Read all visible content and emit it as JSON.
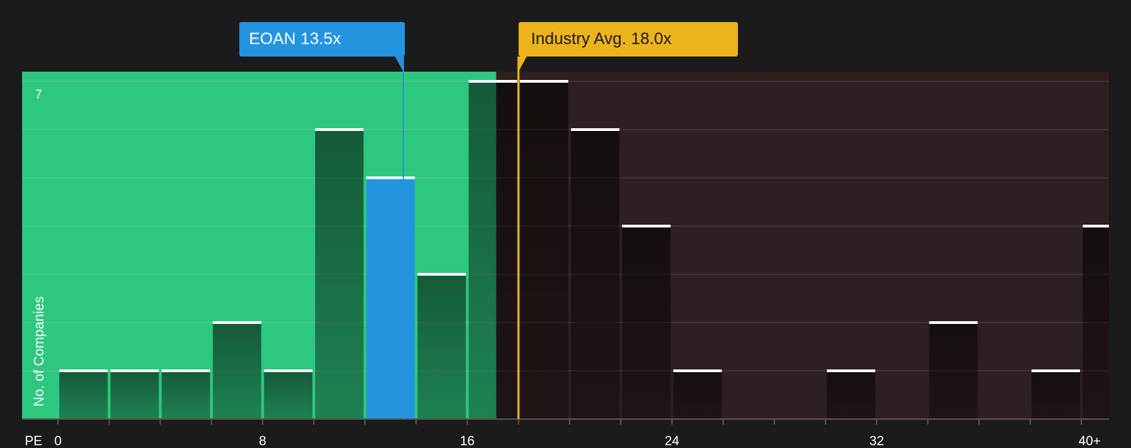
{
  "colors": {
    "background": "#1b1b1b",
    "undervalued_zone": "#2ec77f",
    "overvalued_zone": "#2e1f20",
    "company_bar": "#2394e0",
    "industry_line": "#ecb31b"
  },
  "chart_data": {
    "type": "bar",
    "x_axis_label": "PE",
    "y_axis_label": "No. of Companies",
    "xlim": [
      0,
      40
    ],
    "ylim": [
      0,
      7
    ],
    "x_tick_labels": [
      "0",
      "8",
      "16",
      "24",
      "32",
      "40+"
    ],
    "x_tick_values": [
      0,
      8,
      16,
      24,
      32,
      40
    ],
    "y_tick_labels": [
      "7"
    ],
    "bin_width": 2,
    "bin_starts": [
      0,
      2,
      4,
      6,
      8,
      10,
      12,
      14,
      16,
      18,
      20,
      22,
      24,
      26,
      28,
      30,
      32,
      34,
      36,
      38,
      40
    ],
    "counts": [
      1,
      1,
      1,
      2,
      1,
      6,
      5,
      3,
      7,
      7,
      6,
      4,
      1,
      0,
      0,
      1,
      0,
      2,
      0,
      1,
      4
    ],
    "highlight_bin_start": 12,
    "company": {
      "label": "EOAN",
      "value_text": "13.5x",
      "pe": 13.5
    },
    "industry": {
      "label": "Industry Avg.",
      "value_text": "18.0x",
      "pe": 18.0
    }
  }
}
